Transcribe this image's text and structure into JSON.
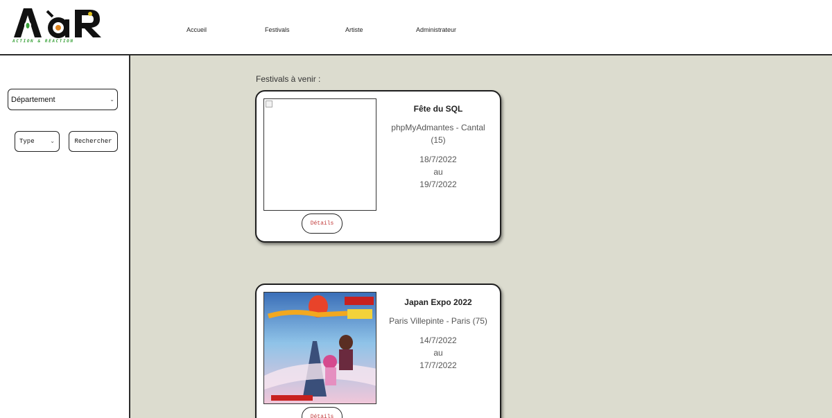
{
  "logo": {
    "text": "AàR",
    "tagline": "ACTION & REACTION"
  },
  "nav": [
    {
      "label": "Accueil"
    },
    {
      "label": "Festivals"
    },
    {
      "label": "Artiste"
    },
    {
      "label": "Administrateur"
    }
  ],
  "filters": {
    "department_placeholder": "Département",
    "type_placeholder": "Type",
    "search_label": "Rechercher"
  },
  "main": {
    "section_title": "Festivals à venir :",
    "festivals": [
      {
        "title": "Fête du SQL",
        "place": "phpMyAdmantes - Cantal (15)",
        "date_start": "18/7/2022",
        "date_sep": "au",
        "date_end": "19/7/2022",
        "details_label": "Détails"
      },
      {
        "title": "Japan Expo 2022",
        "place": "Paris Villepinte - Paris (75)",
        "date_start": "14/7/2022",
        "date_sep": "au",
        "date_end": "17/7/2022",
        "details_label": "Détails"
      }
    ]
  },
  "colors": {
    "page_bg": "#dcdccf",
    "accent_green": "#3aa23a",
    "details_text": "#c23b3b"
  }
}
